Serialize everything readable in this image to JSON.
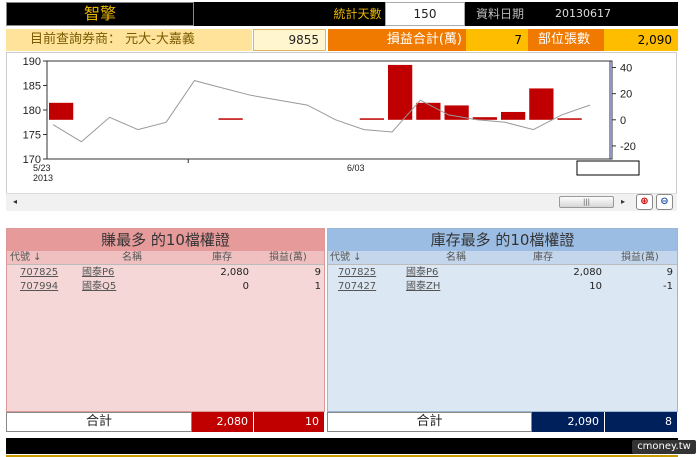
{
  "header": {
    "title": "智擎",
    "stat_days_label": "統計天數",
    "stat_days_value": "150",
    "date_label": "資料日期",
    "date_value": "20130617"
  },
  "summary": {
    "broker_label": "目前查詢券商：",
    "broker_name": "元大-大嘉義",
    "broker_code": "9855",
    "pnl_label": "損益合計(萬)",
    "pnl_value": "7",
    "position_label": "部位張數",
    "position_value": "2,090"
  },
  "chart_data": {
    "type": "bar+line",
    "x_labels": [
      "5/23\n2013",
      "6/03"
    ],
    "left_axis": {
      "ticks": [
        170,
        175,
        180,
        185,
        190
      ],
      "ylim": [
        170,
        190
      ]
    },
    "right_axis": {
      "ticks": [
        -20,
        0,
        20,
        40
      ],
      "ylim": [
        -30,
        45
      ]
    },
    "line_series": {
      "axis": "left",
      "color": "#999999",
      "values": [
        177,
        173.5,
        178.5,
        176,
        177.5,
        186,
        184.5,
        183,
        182,
        181,
        178,
        176,
        175.5,
        182,
        179,
        178,
        177.5,
        176,
        179,
        181
      ]
    },
    "bar_series": {
      "axis": "right",
      "color": "#c00000",
      "values": [
        13,
        0,
        0,
        0,
        0,
        0,
        0.5,
        0,
        0,
        0,
        0,
        1,
        42,
        13,
        11,
        2,
        6,
        24,
        0.5,
        0
      ]
    },
    "colors": {
      "bar": "#c00000",
      "line": "#999999",
      "cursor": "#2a2a8a"
    }
  },
  "scrollbar": {
    "thumb_label": "|||"
  },
  "zoom": {
    "in_icon": "zoom-in-icon",
    "out_icon": "zoom-out-icon"
  },
  "left_panel": {
    "title": "賺最多 的10檔權證",
    "columns": [
      "代號 ↓",
      "名稱",
      "庫存",
      "損益(萬)"
    ],
    "rows": [
      {
        "code": "707825",
        "name": "國泰P6",
        "stock": "2,080",
        "pnl": "9"
      },
      {
        "code": "707994",
        "name": "國泰Q5",
        "stock": "0",
        "pnl": "1"
      }
    ],
    "total_label": "合計",
    "total_stock": "2,080",
    "total_pnl": "10"
  },
  "right_panel": {
    "title": "庫存最多 的10檔權證",
    "columns": [
      "代號 ↓",
      "名稱",
      "庫存",
      "損益(萬)"
    ],
    "rows": [
      {
        "code": "707825",
        "name": "國泰P6",
        "stock": "2,080",
        "pnl": "9"
      },
      {
        "code": "707427",
        "name": "國泰ZH",
        "stock": "10",
        "pnl": "-1"
      }
    ],
    "total_label": "合計",
    "total_stock": "2,090",
    "total_pnl": "8"
  },
  "watermark": "cmoney.tw"
}
